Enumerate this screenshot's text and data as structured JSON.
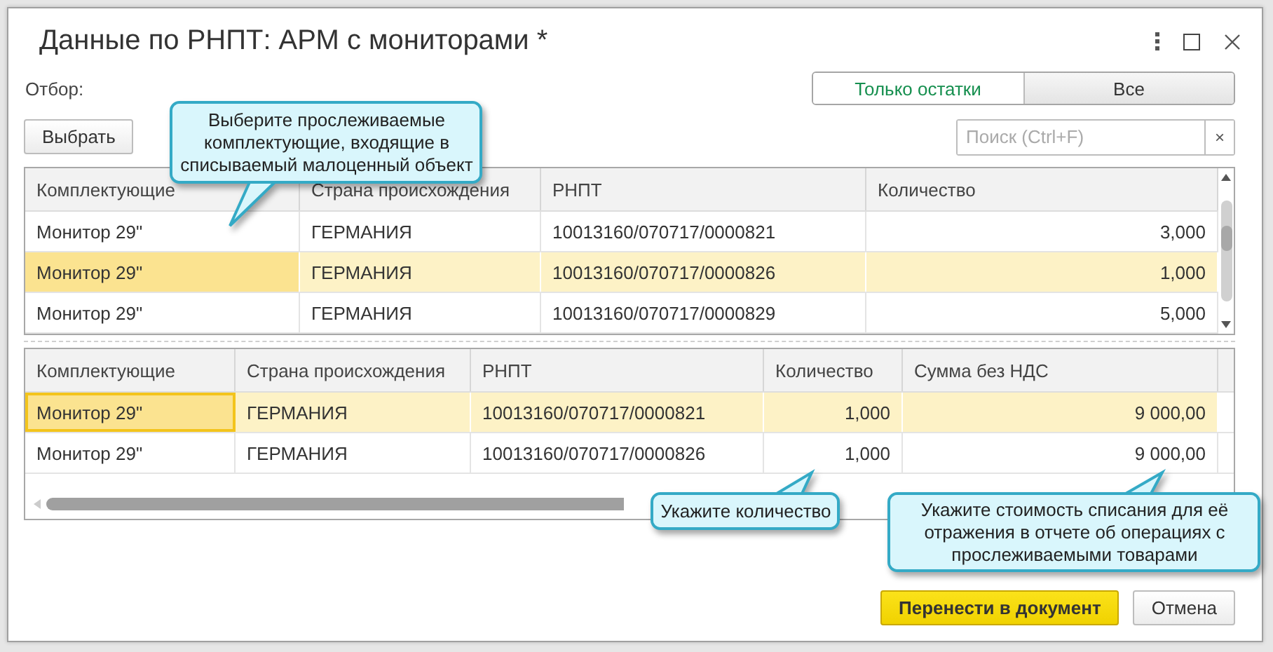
{
  "window": {
    "title": "Данные по РНПТ: АРМ с мониторами *"
  },
  "filter": {
    "label": "Отбор:",
    "options": [
      {
        "label": "Только остатки",
        "selected": true
      },
      {
        "label": "Все",
        "selected": false
      }
    ]
  },
  "select_button": {
    "label": "Выбрать"
  },
  "search": {
    "placeholder": "Поиск (Ctrl+F)",
    "clear": "×"
  },
  "tables": [
    {
      "columns": [
        "Комплектующие",
        "Страна происхождения",
        "РНПТ",
        "Количество"
      ],
      "rows": [
        {
          "cells": [
            "Монитор 29\"",
            "ГЕРМАНИЯ",
            "10013160/070717/0000821",
            "3,000"
          ],
          "selected": false
        },
        {
          "cells": [
            "Монитор 29\"",
            "ГЕРМАНИЯ",
            "10013160/070717/0000826",
            "1,000"
          ],
          "selected": true
        },
        {
          "cells": [
            "Монитор 29\"",
            "ГЕРМАНИЯ",
            "10013160/070717/0000829",
            "5,000"
          ],
          "selected": false
        }
      ]
    },
    {
      "columns": [
        "Комплектующие",
        "Страна происхождения",
        "РНПТ",
        "Количество",
        "Сумма без НДС"
      ],
      "rows": [
        {
          "cells": [
            "Монитор 29\"",
            "ГЕРМАНИЯ",
            "10013160/070717/0000821",
            "1,000",
            "9 000,00"
          ],
          "selected": true
        },
        {
          "cells": [
            "Монитор 29\"",
            "ГЕРМАНИЯ",
            "10013160/070717/0000826",
            "1,000",
            "9 000,00"
          ],
          "selected": false
        }
      ]
    }
  ],
  "buttons": [
    {
      "label": "Перенести в документ",
      "kind": "primary"
    },
    {
      "label": "Отмена",
      "kind": "default"
    }
  ],
  "callouts": [
    {
      "text": "Выберите прослеживаемые комплектующие, входящие в списываемый малоценный объект"
    },
    {
      "text": "Укажите количество"
    },
    {
      "text": "Укажите стоимость списания для её отражения в отчете об операциях с прослеживаемыми товарами"
    }
  ]
}
